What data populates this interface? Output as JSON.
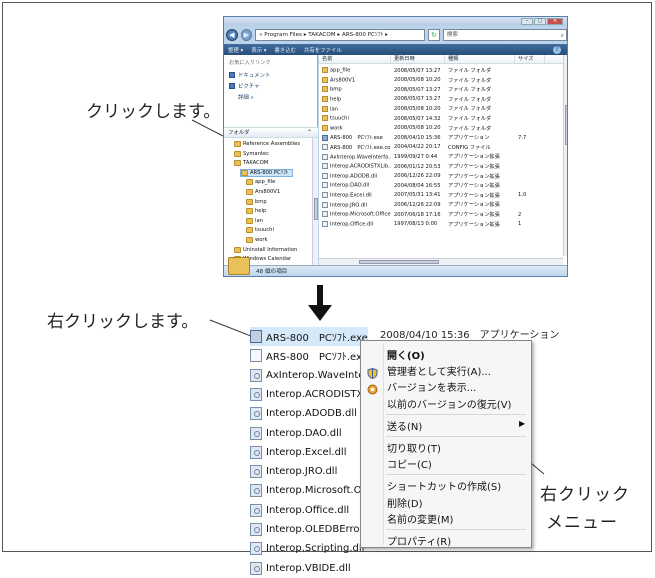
{
  "annotations": {
    "top_click": "クリックします。",
    "bottom_right_click": "右クリックします。",
    "menu_caption_line1": "右クリック",
    "menu_caption_line2": "メニュー"
  },
  "explorer": {
    "window_buttons": [
      "–",
      "□",
      "×"
    ],
    "address_path": "« Program Files ▸ TAKACOM ▸ ARS-800 PCｿﾌﾄ ▸",
    "search_placeholder": "検索",
    "toolbar": [
      "整理 ▾",
      "表示 ▾",
      "書き込む",
      "共有をファイル"
    ],
    "favorites_header": "お気に入りリンク",
    "favorites": [
      "ドキュメント",
      "ピクチャ",
      "詳細 »"
    ],
    "folder_header": "フォルダ",
    "tree": [
      {
        "label": "Reference Assemblies",
        "indent": 1
      },
      {
        "label": "Symantec",
        "indent": 1
      },
      {
        "label": "TAKACOM",
        "indent": 1
      },
      {
        "label": "ARS-800 PCｿﾌﾄ",
        "indent": 2,
        "selected": true
      },
      {
        "label": "app_file",
        "indent": 3
      },
      {
        "label": "Ars800V1",
        "indent": 3
      },
      {
        "label": "bmp",
        "indent": 3
      },
      {
        "label": "help",
        "indent": 3
      },
      {
        "label": "lan",
        "indent": 3
      },
      {
        "label": "tsuuchi",
        "indent": 3
      },
      {
        "label": "work",
        "indent": 3
      },
      {
        "label": "Uninstall Information",
        "indent": 1
      },
      {
        "label": "Windows Calendar",
        "indent": 1
      }
    ],
    "columns": [
      "名前",
      "更新日時",
      "種類",
      "サイズ"
    ],
    "files": [
      {
        "name": "app_file",
        "date": "2008/05/07 13:27",
        "type": "ファイル フォルダ",
        "size": "",
        "icon": "f"
      },
      {
        "name": "Ars800V1",
        "date": "2008/05/08 10:20",
        "type": "ファイル フォルダ",
        "size": "",
        "icon": "f"
      },
      {
        "name": "bmp",
        "date": "2008/05/07 13:27",
        "type": "ファイル フォルダ",
        "size": "",
        "icon": "f"
      },
      {
        "name": "help",
        "date": "2008/05/07 13:27",
        "type": "ファイル フォルダ",
        "size": "",
        "icon": "f"
      },
      {
        "name": "lan",
        "date": "2008/05/08 10:20",
        "type": "ファイル フォルダ",
        "size": "",
        "icon": "f"
      },
      {
        "name": "tsuuchi",
        "date": "2008/05/07 14:32",
        "type": "ファイル フォルダ",
        "size": "",
        "icon": "f"
      },
      {
        "name": "work",
        "date": "2008/05/08 10:20",
        "type": "ファイル フォルダ",
        "size": "",
        "icon": "f"
      },
      {
        "name": "ARS-800　PCｿﾌﾄ.exe",
        "date": "2008/04/10 15:36",
        "type": "アプリケーション",
        "size": "7,7",
        "icon": "e"
      },
      {
        "name": "ARS-800　PCｿﾌﾄ.exe.co...",
        "date": "2004/04/22 20:17",
        "type": "CONFIG ファイル",
        "size": "",
        "icon": "d"
      },
      {
        "name": "AxInterop.WaveInterfa...",
        "date": "1999/09/27 0:44",
        "type": "アプリケーション拡張",
        "size": "",
        "icon": "d"
      },
      {
        "name": "Interop.ACRODISTXLib...",
        "date": "2006/01/12 20:53",
        "type": "アプリケーション拡張",
        "size": "",
        "icon": "d"
      },
      {
        "name": "Interop.ADODB.dll",
        "date": "2006/12/26 22:09",
        "type": "アプリケーション拡張",
        "size": "",
        "icon": "d"
      },
      {
        "name": "Interop.DAO.dll",
        "date": "2004/08/04 16:55",
        "type": "アプリケーション拡張",
        "size": "",
        "icon": "d"
      },
      {
        "name": "Interop.Excel.dll",
        "date": "2007/05/31 13:41",
        "type": "アプリケーション拡張",
        "size": "1,0",
        "icon": "d"
      },
      {
        "name": "Interop.JRO.dll",
        "date": "2006/12/26 22:09",
        "type": "アプリケーション拡張",
        "size": "",
        "icon": "d"
      },
      {
        "name": "Interop.Microsoft.Office...",
        "date": "2007/06/18 17:16",
        "type": "アプリケーション拡張",
        "size": "2",
        "icon": "d"
      },
      {
        "name": "Interop.Office.dll",
        "date": "1997/08/13 0:00",
        "type": "アプリケーション拡張",
        "size": "1",
        "icon": "d"
      }
    ],
    "status": "48 個の項目"
  },
  "zoomed_list": {
    "rows": [
      {
        "name": "ARS-800　PCｿﾌﾄ.exe",
        "icon": "exe",
        "selected": true
      },
      {
        "name": "ARS-800　PCｿﾌﾄ.exe.c",
        "icon": "doc"
      },
      {
        "name": "AxInterop.WaveInterf",
        "icon": "gear"
      },
      {
        "name": "Interop.ACRODISTXLI",
        "icon": "gear"
      },
      {
        "name": "Interop.ADODB.dll",
        "icon": "gear"
      },
      {
        "name": "Interop.DAO.dll",
        "icon": "gear"
      },
      {
        "name": "Interop.Excel.dll",
        "icon": "gear"
      },
      {
        "name": "Interop.JRO.dll",
        "icon": "gear"
      },
      {
        "name": "Interop.Microsoft.Offic",
        "icon": "gear"
      },
      {
        "name": "Interop.Office.dll",
        "icon": "gear"
      },
      {
        "name": "Interop.OLEDBError.dl",
        "icon": "gear"
      },
      {
        "name": "Interop.Scripting.dll",
        "icon": "gear"
      },
      {
        "name": "Interop.VBIDE.dll",
        "icon": "gear"
      }
    ],
    "selected_row_tail": "2008/04/10 15:36　アプリケーション"
  },
  "context_menu": {
    "items": [
      {
        "label": "開く(O)",
        "bold": true
      },
      {
        "label": "管理者として実行(A)...",
        "icon": "shield"
      },
      {
        "label": "バージョンを表示...",
        "icon": "version"
      },
      {
        "label": "以前のバージョンの復元(V)"
      },
      {
        "separator": true
      },
      {
        "label": "送る(N)",
        "submenu": true
      },
      {
        "separator": true
      },
      {
        "label": "切り取り(T)"
      },
      {
        "label": "コピー(C)"
      },
      {
        "separator": true
      },
      {
        "label": "ショートカットの作成(S)"
      },
      {
        "label": "削除(D)"
      },
      {
        "label": "名前の変更(M)"
      },
      {
        "separator": true
      },
      {
        "label": "プロパティ(R)"
      }
    ]
  }
}
